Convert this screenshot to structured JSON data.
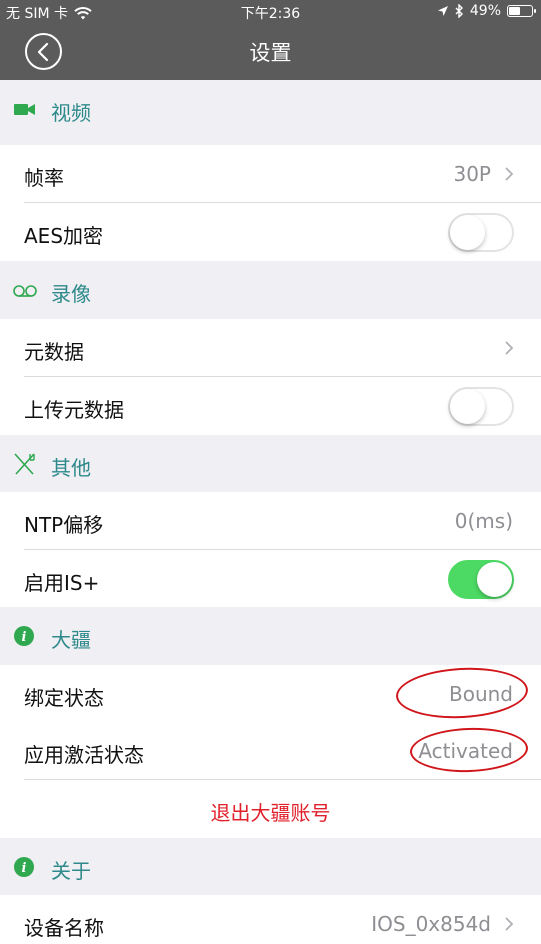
{
  "status_bar": {
    "carrier": "无 SIM 卡",
    "time": "下午2:36",
    "battery_percent": "49%",
    "battery_level": 0.49,
    "icons": [
      "wifi-icon",
      "location-icon",
      "bluetooth-icon",
      "battery-icon"
    ]
  },
  "nav": {
    "title": "设置",
    "back_icon": "chevron-left-icon"
  },
  "sections": {
    "video": {
      "title": "视频",
      "icon": "video-camera-icon",
      "rows": {
        "frame_rate": {
          "label": "帧率",
          "value": "30P"
        },
        "aes": {
          "label": "AES加密",
          "on": false
        }
      }
    },
    "record": {
      "title": "录像",
      "icon": "voicemail-icon",
      "rows": {
        "metadata": {
          "label": "元数据"
        },
        "upload_metadata": {
          "label": "上传元数据",
          "on": false
        }
      }
    },
    "other": {
      "title": "其他",
      "icon": "fork-knife-icon",
      "rows": {
        "ntp": {
          "label": "NTP偏移",
          "value": "0(ms)"
        },
        "is_plus": {
          "label": "启用IS+",
          "on": true
        }
      }
    },
    "dji": {
      "title": "大疆",
      "icon": "info-icon",
      "rows": {
        "bind": {
          "label": "绑定状态",
          "value": "Bound"
        },
        "activation": {
          "label": "应用激活状态",
          "value": "Activated"
        }
      },
      "logout_label": "退出大疆账号"
    },
    "about": {
      "title": "关于",
      "icon": "info-icon",
      "rows": {
        "device_name": {
          "label": "设备名称",
          "value": "IOS_0x854d"
        }
      }
    }
  },
  "colors": {
    "nav_bg": "#5b5b5b",
    "section_text": "#2e8a8a",
    "icon_green": "#2fa84f",
    "toggle_on": "#4cd964",
    "danger": "#e0202a",
    "annotation": "#d0161b"
  }
}
